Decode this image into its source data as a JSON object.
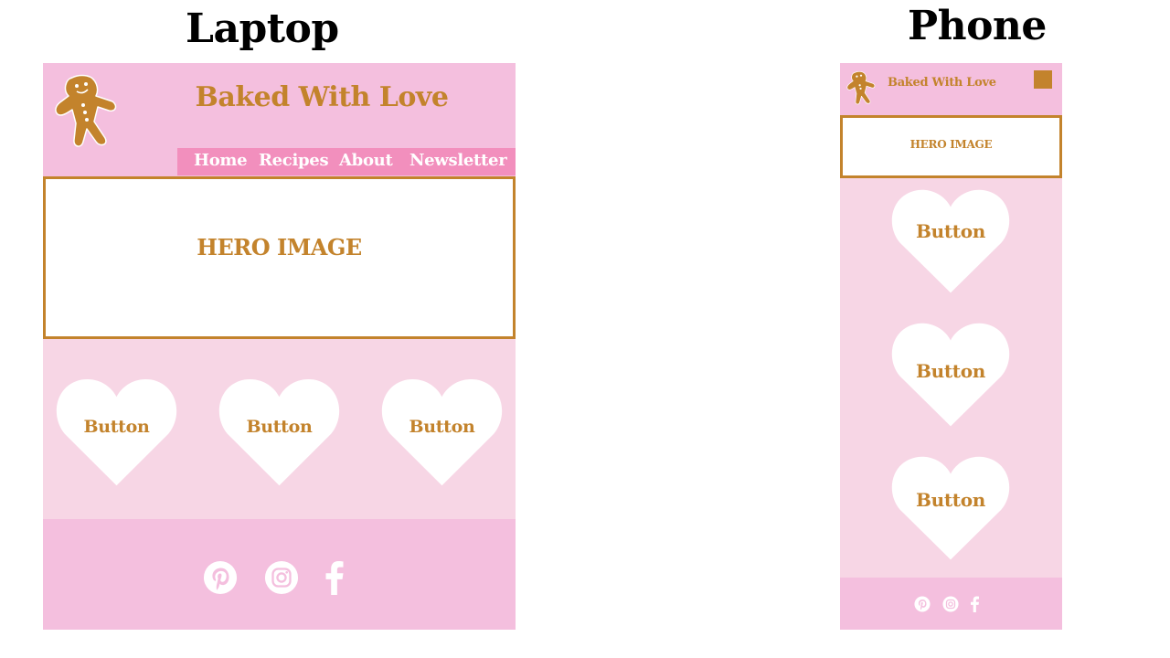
{
  "captions": {
    "laptop": "Laptop",
    "phone": "Phone"
  },
  "laptop": {
    "brand": "Baked With Love",
    "nav": [
      "Home",
      "Recipes",
      "About",
      "Newsletter"
    ],
    "hero": "HERO IMAGE",
    "buttons": [
      "Button",
      "Button",
      "Button"
    ]
  },
  "phone": {
    "brand": "Baked With Love",
    "hero": "HERO IMAGE",
    "buttons": [
      "Button",
      "Button",
      "Button"
    ]
  },
  "social_icons": [
    "pinterest-icon",
    "instagram-icon",
    "facebook-icon"
  ],
  "colors": {
    "header_pink": "#f4bfde",
    "body_pink": "#f7d6e5",
    "nav_pink": "#f28fbd",
    "accent_gold": "#c3832c",
    "white": "#ffffff"
  }
}
